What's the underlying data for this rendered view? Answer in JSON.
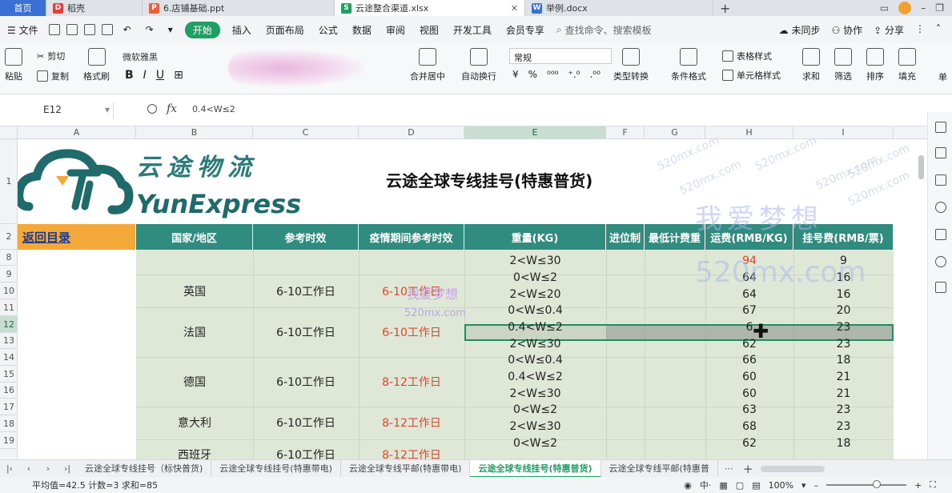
{
  "tabs": [
    {
      "label": "首页",
      "type": "home"
    },
    {
      "label": "稻壳",
      "type": "docer",
      "color": "#e0403a"
    },
    {
      "label": "6.店铺基础.ppt",
      "type": "ppt",
      "color": "#e8603c"
    },
    {
      "label": "云途整合渠道.xlsx",
      "type": "xlsx",
      "color": "#1f9f63",
      "active": true
    },
    {
      "label": "举例.docx",
      "type": "docx",
      "color": "#3c6fd6"
    }
  ],
  "menu": {
    "file": "文件",
    "start": "开始",
    "items": [
      "插入",
      "页面布局",
      "公式",
      "数据",
      "审阅",
      "视图",
      "开发工具",
      "会员专享"
    ],
    "search": "查找命令、搜索模板",
    "sync": "未同步",
    "collab": "协作",
    "share": "分享"
  },
  "ribbon": {
    "paste": "粘贴",
    "cut": "剪切",
    "copy": "复制",
    "format_painter": "格式刷",
    "font": "微软雅黑",
    "merge": "合并居中",
    "wrap": "自动换行",
    "number_format": "常规",
    "type_convert": "类型转换",
    "cond_format": "条件格式",
    "table_style": "表格样式",
    "cell_style": "单元格样式",
    "sum": "求和",
    "filter": "筛选",
    "sort": "排序",
    "fill": "填充",
    "single": "单"
  },
  "formula_bar": {
    "cell_ref": "E12",
    "fx": "fx",
    "content": "0.4<W≤2"
  },
  "columns": [
    "A",
    "B",
    "C",
    "D",
    "E",
    "F",
    "G",
    "H",
    "I"
  ],
  "rows": [
    "1",
    "2",
    "8",
    "9",
    "10",
    "11",
    "12",
    "13",
    "14",
    "15",
    "16",
    "17",
    "18",
    "19"
  ],
  "sheet": {
    "company_cn": "云途物流",
    "company_en": "YunExpress",
    "title": "云途全球专线挂号(特惠普货)",
    "back_link": "返回目录",
    "headers": [
      "国家/地区",
      "参考时效",
      "疫情期间参考时效",
      "重量(KG)",
      "进位制",
      "最低计费重",
      "运费(RMB/KG)",
      "挂号费(RMB/票)"
    ],
    "groups": [
      {
        "country": "",
        "time": "",
        "covid_time": ""
      },
      {
        "country": "英国",
        "time": "6-10工作日",
        "covid_time": "6-10工作日"
      },
      {
        "country": "法国",
        "time": "6-10工作日",
        "covid_time": "6-10工作日"
      },
      {
        "country": "德国",
        "time": "6-10工作日",
        "covid_time": "8-12工作日"
      },
      {
        "country": "意大利",
        "time": "6-10工作日",
        "covid_time": "8-12工作日"
      },
      {
        "country": "西班牙",
        "time": "6-10工作日",
        "covid_time": "8-12工作日"
      }
    ],
    "weights": [
      "2<W≤30",
      "0<W≤2",
      "2<W≤20",
      "0<W≤0.4",
      "0.4<W≤2",
      "2<W≤30",
      "0<W≤0.4",
      "0.4<W≤2",
      "2<W≤30",
      "0<W≤2",
      "2<W≤30",
      "0<W≤2"
    ],
    "freight": [
      "94",
      "64",
      "64",
      "67",
      "6",
      "62",
      "66",
      "60",
      "60",
      "63",
      "68",
      "62"
    ],
    "reg_fee": [
      "9",
      "16",
      "16",
      "20",
      "23",
      "23",
      "18",
      "21",
      "21",
      "23",
      "23",
      "18"
    ],
    "freight_red_row8": "#e5422b"
  },
  "watermarks": {
    "big": "我爱梦想",
    "url_big": "520mx.com",
    "mid": "我爱梦想",
    "url_mid": "520mx.com",
    "small": "520mx.com"
  },
  "sheet_tabs": [
    {
      "label": "云途全球专线挂号（标快普货)",
      "active": false
    },
    {
      "label": "云途全球专线挂号(特惠带电)",
      "active": false
    },
    {
      "label": "云途全球专线平邮(特惠带电)",
      "active": false
    },
    {
      "label": "云途全球专线挂号(特惠普货)",
      "active": true
    },
    {
      "label": "云途全球专线平邮(特惠普",
      "active": false
    }
  ],
  "status": {
    "text": "平均值=42.5  计数=3  求和=85",
    "zoom": "100%"
  },
  "colors": {
    "header_teal": "#2f8c7f",
    "back_orange": "#f4a83a",
    "body_green": "#dfe8d6",
    "accent_green": "#1f9f63",
    "red_text": "#e5422b"
  }
}
